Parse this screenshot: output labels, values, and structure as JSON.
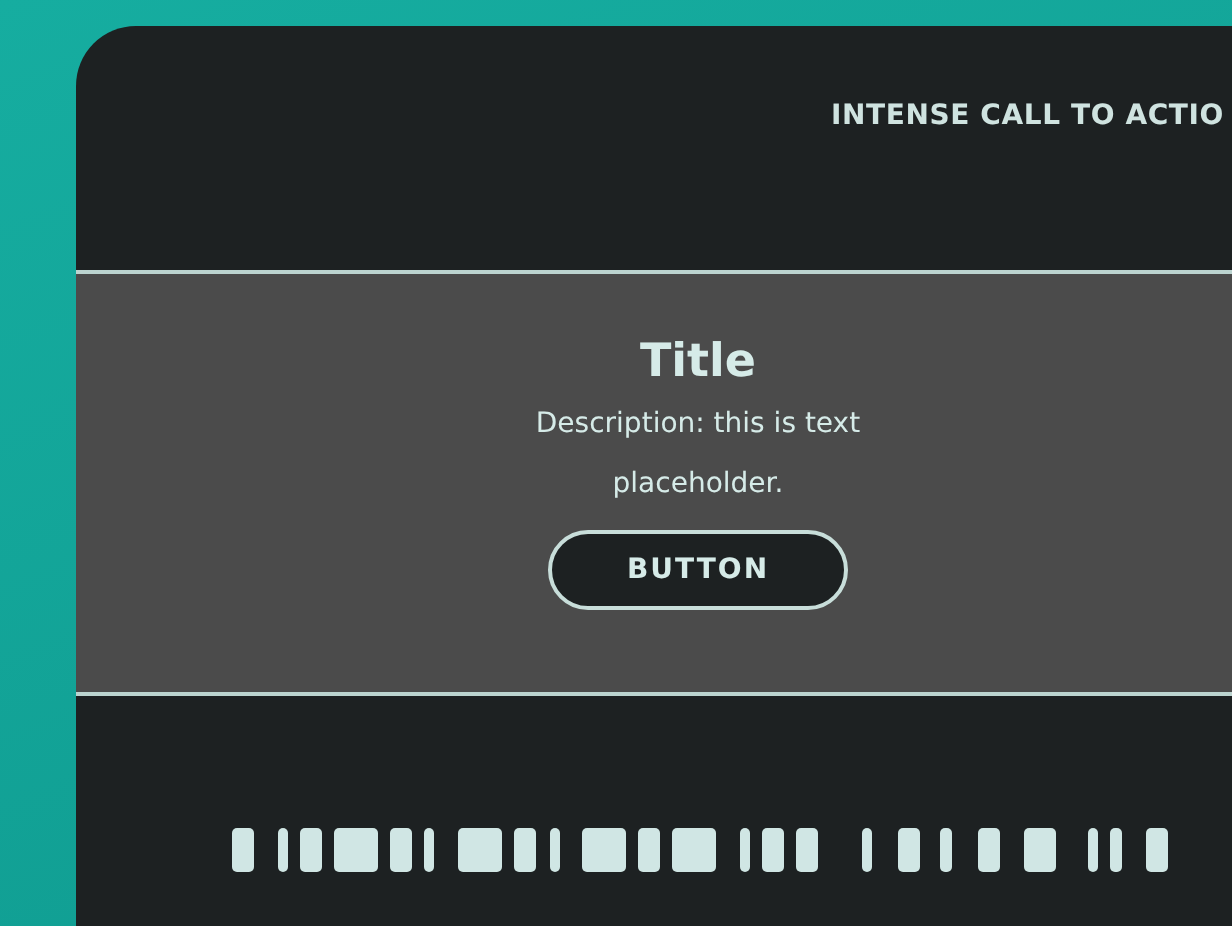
{
  "header": {
    "text": "INTENSE CALL TO ACTIO"
  },
  "banner": {
    "title": "Title",
    "description": "Description: this is text placeholder.",
    "button": "BUTTON"
  }
}
